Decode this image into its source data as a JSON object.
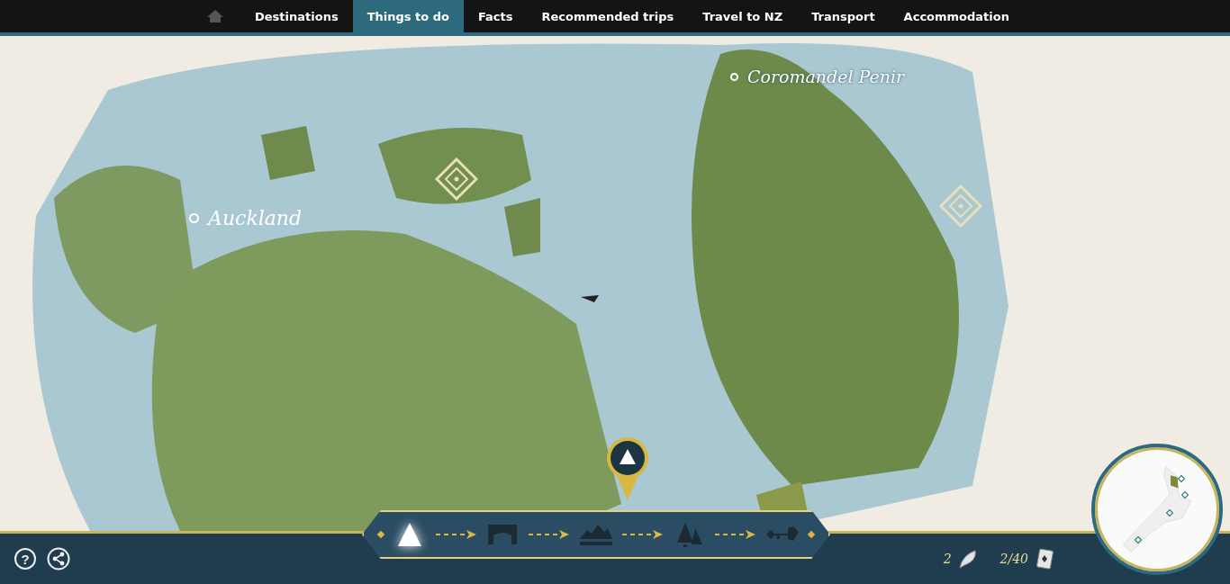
{
  "nav": {
    "items": [
      {
        "label": "Destinations",
        "selected": false
      },
      {
        "label": "Things to do",
        "selected": true
      },
      {
        "label": "Facts",
        "selected": false
      },
      {
        "label": "Recommended trips",
        "selected": false
      },
      {
        "label": "Travel to NZ",
        "selected": false
      },
      {
        "label": "Transport",
        "selected": false
      },
      {
        "label": "Accommodation",
        "selected": false
      }
    ]
  },
  "map": {
    "labels": [
      "Auckland",
      "Coromandel Penir"
    ]
  },
  "journey": {
    "steps": [
      {
        "kind": "peak",
        "selected": true
      },
      {
        "kind": "bridge",
        "selected": false
      },
      {
        "kind": "ridge",
        "selected": false
      },
      {
        "kind": "forest",
        "selected": false
      },
      {
        "kind": "key",
        "selected": false
      }
    ]
  },
  "footer": {
    "help": "?",
    "feathers": "2",
    "cards": "2/40"
  }
}
